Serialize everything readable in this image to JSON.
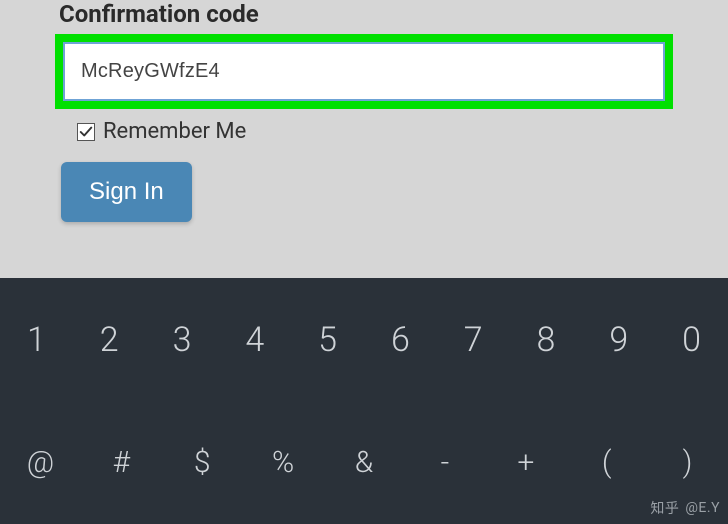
{
  "form": {
    "label": "Confirmation code",
    "code_value": "McReyGWfzE4",
    "remember_label": "Remember Me",
    "remember_checked": true,
    "signin_label": "Sign In"
  },
  "keyboard": {
    "row1": [
      "1",
      "2",
      "3",
      "4",
      "5",
      "6",
      "7",
      "8",
      "9",
      "0"
    ],
    "row2": [
      "@",
      "#",
      "$",
      "%",
      "&",
      "-",
      "+",
      "(",
      ")"
    ]
  },
  "watermark": {
    "site": "知乎",
    "handle": "@E.Y"
  }
}
